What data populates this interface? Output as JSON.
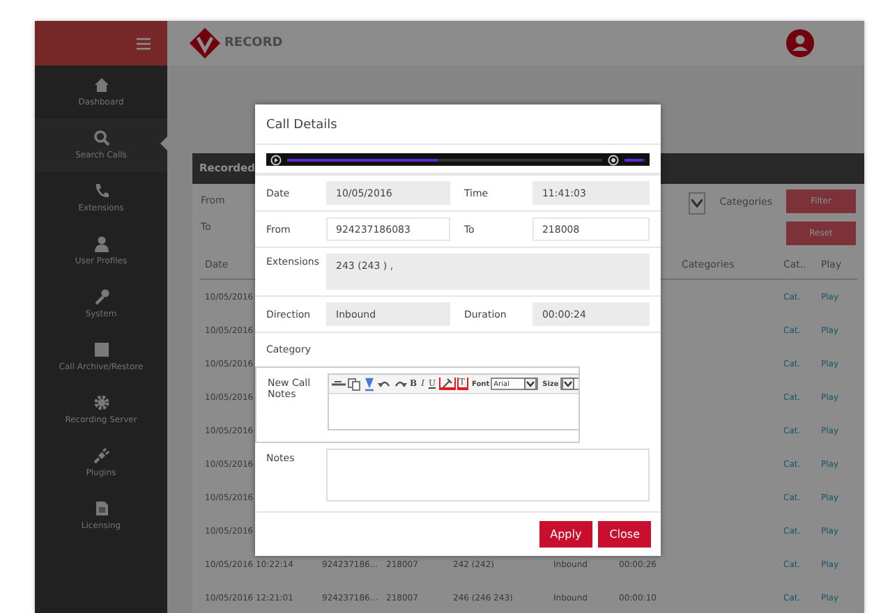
{
  "header": {
    "brand": "RECORD"
  },
  "sidebar": {
    "items": [
      {
        "label": "Dashboard",
        "selected": false
      },
      {
        "label": "Search Calls",
        "selected": true
      },
      {
        "label": "Extensions",
        "selected": false
      },
      {
        "label": "User Profiles",
        "selected": false
      },
      {
        "label": "System",
        "selected": false
      },
      {
        "label": "Call Archive/Restore",
        "selected": false
      },
      {
        "label": "Recording Server",
        "selected": false
      },
      {
        "label": "Plugins",
        "selected": false
      },
      {
        "label": "Licensing",
        "selected": false
      }
    ]
  },
  "panel": {
    "title": "Recorded",
    "filters": [
      {
        "label": "From"
      },
      {
        "label": "To"
      }
    ],
    "categories_label": "Categories",
    "buttons": [
      "Filter",
      "Reset"
    ],
    "columns": [
      "Date",
      "",
      "",
      "",
      "",
      "",
      "Categories",
      "Cat..",
      "Play"
    ],
    "rows": [
      {
        "cells": [
          "10/05/2016",
          "",
          "",
          "",
          "",
          "",
          "",
          "Cat.",
          "Play"
        ]
      },
      {
        "cells": [
          "10/05/2016",
          "",
          "",
          "",
          "",
          "",
          "",
          "Cat.",
          "Play"
        ]
      },
      {
        "cells": [
          "10/05/2016",
          "",
          "",
          "",
          "",
          "",
          "",
          "Cat.",
          "Play"
        ]
      },
      {
        "cells": [
          "10/05/2016",
          "",
          "",
          "",
          "",
          "",
          "",
          "Cat.",
          "Play"
        ]
      },
      {
        "cells": [
          "10/05/2016",
          "",
          "",
          "",
          "",
          "",
          "",
          "Cat.",
          "Play"
        ]
      },
      {
        "cells": [
          "10/05/2016",
          "",
          "",
          "",
          "",
          "",
          "",
          "Cat.",
          "Play"
        ]
      },
      {
        "cells": [
          "10/05/2016",
          "",
          "",
          "",
          "",
          "",
          "",
          "Cat.",
          "Play"
        ]
      },
      {
        "cells": [
          "10/05/2016",
          "",
          "",
          "",
          "",
          "",
          "",
          "Cat.",
          "Play"
        ]
      },
      {
        "cells": [
          "10/05/2016 10:22:14",
          "924237186...",
          "218007",
          "242 (242)",
          "Inbound",
          "00:00:26",
          "",
          "Cat.",
          "Play"
        ]
      },
      {
        "cells": [
          "10/05/2016 12:21:01",
          "924237186...",
          "218007",
          "246 (246 243)",
          "Inbound",
          "00:00:10",
          "",
          "Cat.",
          "Play"
        ]
      }
    ]
  },
  "modal": {
    "title": "Call Details",
    "player": {
      "progress": {
        "level": 0.48
      },
      "volume": {
        "level": 0.85
      }
    },
    "rows": [
      {
        "kind": "pair",
        "fields": [
          {
            "label": "Date",
            "value": "10/05/2016",
            "readonly": true
          },
          {
            "label": "Time",
            "value": "11:41:03",
            "readonly": true
          }
        ]
      },
      {
        "kind": "pair",
        "fields": [
          {
            "label": "From",
            "value": "924237186083",
            "readonly": false
          },
          {
            "label": "To",
            "value": "218008",
            "readonly": false
          }
        ]
      },
      {
        "kind": "wide",
        "fields": [
          {
            "label": "Extensions",
            "value": "243 (243 ) ,",
            "readonly": true
          }
        ]
      },
      {
        "kind": "pair",
        "fields": [
          {
            "label": "Direction",
            "value": "Inbound",
            "readonly": true
          },
          {
            "label": "Duration",
            "value": "00:00:24",
            "readonly": true
          }
        ]
      },
      {
        "kind": "plain",
        "fields": [
          {
            "label": "Category"
          }
        ]
      },
      {
        "kind": "editor",
        "fields": [
          {
            "label": "New Call Notes"
          }
        ]
      },
      {
        "kind": "textarea",
        "fields": [
          {
            "label": "Notes"
          }
        ]
      }
    ],
    "editor": {
      "format_buttons": [
        {
          "kind": "bold",
          "label": "B"
        },
        {
          "kind": "italic",
          "label": "I"
        },
        {
          "kind": "underline",
          "label": "U"
        }
      ],
      "color_buttons": [
        {
          "kind": "highlight"
        },
        {
          "kind": "text",
          "label": "T"
        }
      ],
      "font_label": "Font",
      "font_value": "Arial",
      "size_label": "Size"
    },
    "buttons": [
      "Apply",
      "Close"
    ]
  }
}
